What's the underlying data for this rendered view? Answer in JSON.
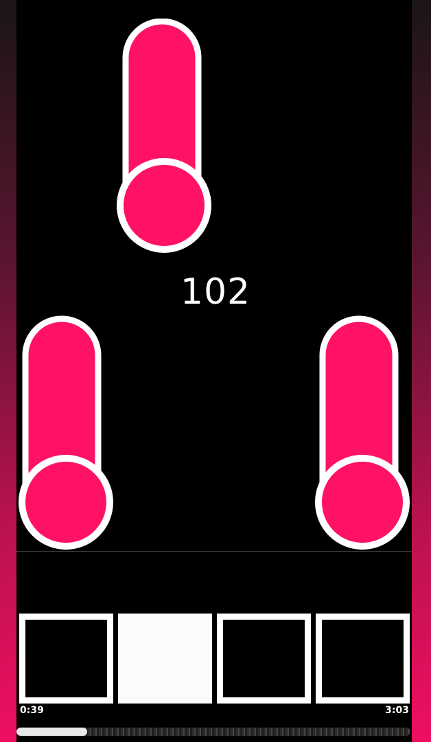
{
  "game": {
    "score": "102",
    "accent_color": "#ff1266",
    "outline_color": "#ffffff",
    "notes": [
      {
        "lane": 2,
        "type": "hold-note"
      },
      {
        "lane": 1,
        "type": "hold-note"
      },
      {
        "lane": 4,
        "type": "hold-note"
      }
    ],
    "pads": [
      {
        "lane": 1,
        "pressed": false
      },
      {
        "lane": 2,
        "pressed": true
      },
      {
        "lane": 3,
        "pressed": false
      },
      {
        "lane": 4,
        "pressed": false
      }
    ]
  },
  "player": {
    "elapsed": "0:39",
    "total": "3:03",
    "progress": 0.18
  }
}
